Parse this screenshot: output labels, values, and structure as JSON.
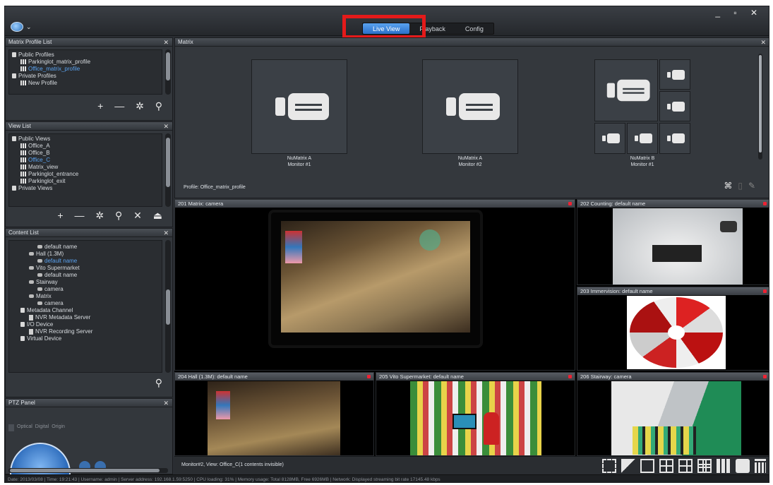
{
  "topbar": {
    "tabs": [
      {
        "label": "Live View",
        "active": true
      },
      {
        "label": "Playback",
        "active": false
      },
      {
        "label": "Config",
        "active": false
      }
    ],
    "window_controls": "_ ▫ ✕"
  },
  "matrix_profile_list": {
    "title": "Matrix Profile List",
    "items": [
      {
        "label": "Public Profiles",
        "indent": 0,
        "icon": "folder-icon"
      },
      {
        "label": "Parkinglot_matrix_profile",
        "indent": 1,
        "icon": "grid-icon"
      },
      {
        "label": "Office_matrix_profile",
        "indent": 1,
        "icon": "grid-icon",
        "selected": true
      },
      {
        "label": "Private Profiles",
        "indent": 0,
        "icon": "folder-icon"
      },
      {
        "label": "New Profile",
        "indent": 1,
        "icon": "grid-icon"
      }
    ],
    "tools": "+ — ✲ ⚲"
  },
  "view_list": {
    "title": "View List",
    "items": [
      {
        "label": "Public Views",
        "indent": 0,
        "icon": "folder-icon"
      },
      {
        "label": "Office_A",
        "indent": 1,
        "icon": "grid-icon"
      },
      {
        "label": "Office_B",
        "indent": 1,
        "icon": "grid-icon"
      },
      {
        "label": "Office_C",
        "indent": 1,
        "icon": "grid-icon",
        "selected": true
      },
      {
        "label": "Matrix_view",
        "indent": 1,
        "icon": "grid-icon"
      },
      {
        "label": "Parkinglot_entrance",
        "indent": 1,
        "icon": "grid-icon"
      },
      {
        "label": "Parkinglot_exit",
        "indent": 1,
        "icon": "grid-icon"
      },
      {
        "label": "Private Views",
        "indent": 0,
        "icon": "folder-icon"
      }
    ],
    "tools": "+ — ✲ ⚲ ✕ ⏏"
  },
  "content_list": {
    "title": "Content List",
    "items": [
      {
        "label": "default name",
        "indent": 3,
        "icon": "camera-icon"
      },
      {
        "label": "Hall (1.3M)",
        "indent": 2,
        "icon": "camera-icon"
      },
      {
        "label": "default name",
        "indent": 3,
        "icon": "camera-icon",
        "selected": true
      },
      {
        "label": "Vito Supermarket",
        "indent": 2,
        "icon": "camera-icon"
      },
      {
        "label": "default name",
        "indent": 3,
        "icon": "camera-icon"
      },
      {
        "label": "Stairway",
        "indent": 2,
        "icon": "camera-icon"
      },
      {
        "label": "camera",
        "indent": 3,
        "icon": "camera-icon"
      },
      {
        "label": "Matrix",
        "indent": 2,
        "icon": "camera-icon"
      },
      {
        "label": "camera",
        "indent": 3,
        "icon": "camera-icon"
      },
      {
        "label": "Metadata Channel",
        "indent": 1,
        "icon": "folder-icon"
      },
      {
        "label": "NVR Metadata Server",
        "indent": 2,
        "icon": "server-icon"
      },
      {
        "label": "I/O Device",
        "indent": 1,
        "icon": "folder-icon"
      },
      {
        "label": "NVR Recording Server",
        "indent": 2,
        "icon": "server-icon"
      },
      {
        "label": "Virtual Device",
        "indent": 1,
        "icon": "folder-icon"
      }
    ],
    "search": "⚲"
  },
  "ptz_panel": {
    "title": "PTZ Panel",
    "tabs": [
      "Optical",
      "Digital",
      "Origin"
    ]
  },
  "matrix": {
    "title": "Matrix",
    "monitors": [
      {
        "name": "NuMatrix A",
        "monitor": "Monitor #1"
      },
      {
        "name": "NuMatrix A",
        "monitor": "Monitor #2"
      },
      {
        "name": "NuMatrix B",
        "monitor": "Monitor #1"
      }
    ],
    "profile_label": "Profile: Office_matrix_profile"
  },
  "cameras": [
    {
      "title": "201 Matrix: camera"
    },
    {
      "title": "202 Counting: default name"
    },
    {
      "title": "203 Immervision: default name"
    },
    {
      "title": "204 Hall (1.3M): default name"
    },
    {
      "title": "205 Vito Supermarket: default name"
    },
    {
      "title": "206 Stairway: camera"
    }
  ],
  "view_info": "Monitor#2, View: Office_C(1 contents invisible)",
  "status_bar": "Date: 2013/03/08 | Time: 19:21:43 | Username: admin | Server address: 192.168.1.59:5250 | CPU loading: 31% | Memory usage: Total 8128MB, Free 6926MB | Network: Displayed streaming bit rate 17145.48 kbps",
  "colors": {
    "accent": "#2a6fc8",
    "highlight_box": "#e41a1a",
    "record_dot": "#e23"
  }
}
